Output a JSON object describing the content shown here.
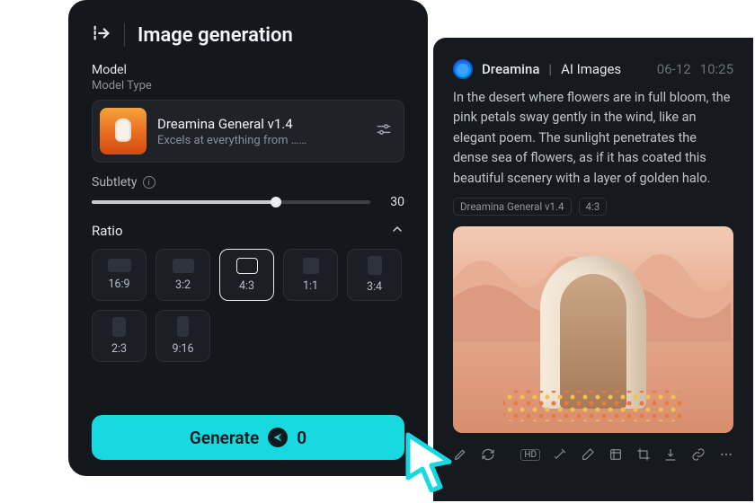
{
  "colors": {
    "accent": "#18d9e0"
  },
  "panel": {
    "title": "Image generation",
    "model_label": "Model",
    "model_type_label": "Model Type",
    "model": {
      "name": "Dreamina General v1.4",
      "desc": "Excels at everything from ……"
    },
    "subtlety": {
      "label": "Subtlety",
      "value": "30"
    },
    "ratio": {
      "label": "Ratio",
      "options": [
        "16:9",
        "3:2",
        "4:3",
        "1:1",
        "3:4",
        "2:3",
        "9:16"
      ],
      "selected": "4:3"
    },
    "generate": {
      "label": "Generate",
      "cost": "0"
    }
  },
  "feed": {
    "brand": "Dreamina",
    "section": "AI Images",
    "date": "06-12",
    "time": "10:25",
    "prompt": "In the desert where flowers are in full bloom, the pink petals sway gently in the wind, like an elegant poem. The sunlight penetrates the dense sea of flowers, as if it has coated this beautiful scenery with a layer of golden halo.",
    "chips": {
      "model": "Dreamina General v1.4",
      "ratio": "4:3"
    },
    "toolbar": {
      "hd": "HD"
    }
  }
}
